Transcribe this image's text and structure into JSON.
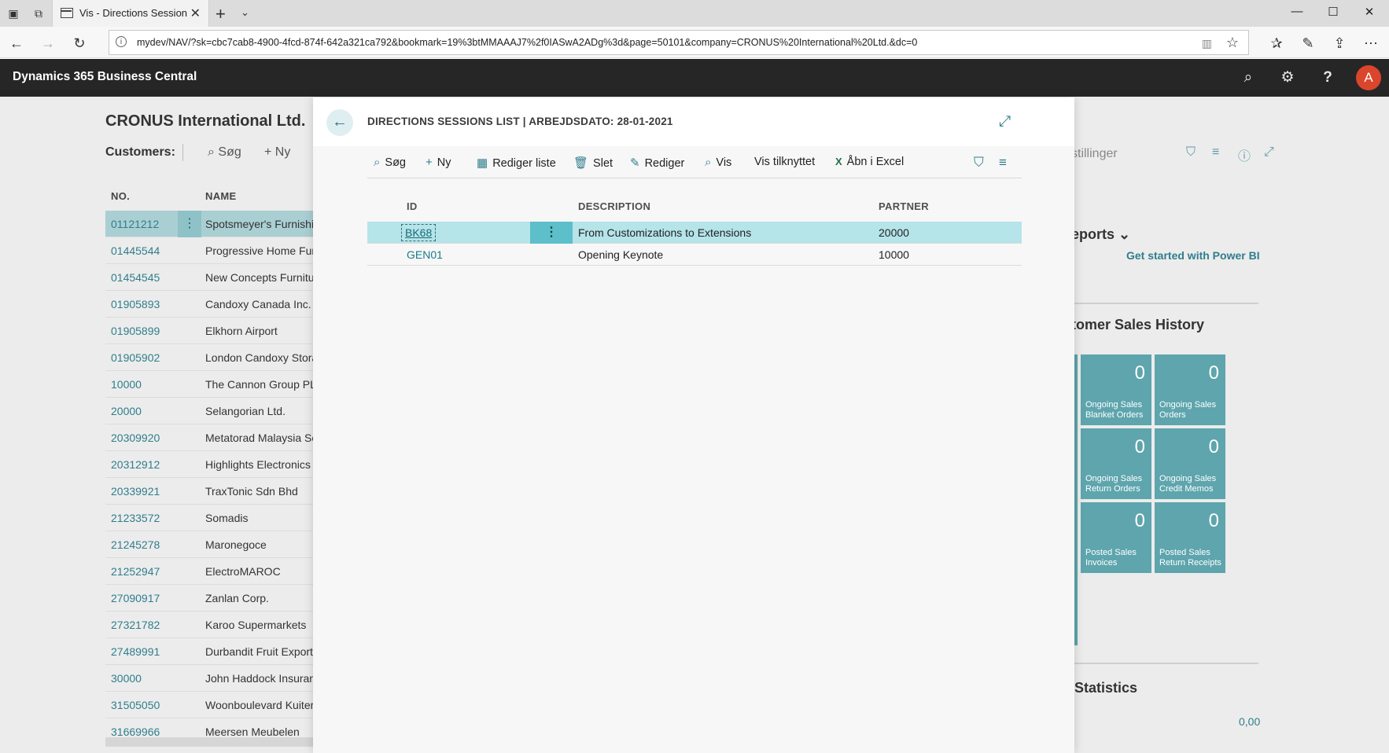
{
  "browser": {
    "tab_title": "Vis - Directions Session:",
    "url": "mydev/NAV/?sk=cbc7cab8-4900-4fcd-874f-642a321ca792&bookmark=19%3btMMAAAJ7%2f0IASwA2ADg%3d&page=50101&company=CRONUS%20International%20Ltd.&dc=0"
  },
  "app": {
    "brand": "Dynamics 365 Business Central",
    "avatar_initial": "A"
  },
  "background": {
    "company": "CRONUS International Ltd.",
    "customers_label": "Customers:",
    "search_label": "Søg",
    "new_label": "Ny",
    "col_no": "NO.",
    "col_name": "NAME",
    "rows": [
      {
        "no": "01121212",
        "name": "Spotsmeyer's Furnishi"
      },
      {
        "no": "01445544",
        "name": "Progressive Home Fur"
      },
      {
        "no": "01454545",
        "name": "New Concepts Furnitu"
      },
      {
        "no": "01905893",
        "name": "Candoxy Canada Inc."
      },
      {
        "no": "01905899",
        "name": "Elkhorn Airport"
      },
      {
        "no": "01905902",
        "name": "London Candoxy Stora"
      },
      {
        "no": "10000",
        "name": "The Cannon Group PLC"
      },
      {
        "no": "20000",
        "name": "Selangorian Ltd."
      },
      {
        "no": "20309920",
        "name": "Metatorad Malaysia Sc"
      },
      {
        "no": "20312912",
        "name": "Highlights Electronics"
      },
      {
        "no": "20339921",
        "name": "TraxTonic Sdn Bhd"
      },
      {
        "no": "21233572",
        "name": "Somadis"
      },
      {
        "no": "21245278",
        "name": "Maronegoce"
      },
      {
        "no": "21252947",
        "name": "ElectroMAROC"
      },
      {
        "no": "27090917",
        "name": "Zanlan Corp."
      },
      {
        "no": "27321782",
        "name": "Karoo Supermarkets"
      },
      {
        "no": "27489991",
        "name": "Durbandit Fruit Export"
      },
      {
        "no": "30000",
        "name": "John Haddock Insuran"
      },
      {
        "no": "31505050",
        "name": "Woonboulevard Kuiter"
      },
      {
        "no": "31669966",
        "name": "Meersen Meubelen"
      }
    ],
    "stillinger_text": "stillinger",
    "reports_text": "eports",
    "power_bi_link": "Get started with Power BI",
    "sales_history_title": "tomer Sales History",
    "tiles": [
      {
        "value": "0",
        "label": "Ongoing Sales Blanket Orders"
      },
      {
        "value": "0",
        "label": "Ongoing Sales Orders"
      },
      {
        "value": "0",
        "label": "Ongoing Sales Return Orders"
      },
      {
        "value": "0",
        "label": "Ongoing Sales Credit Memos"
      },
      {
        "value": "0",
        "label": "Posted Sales Invoices"
      },
      {
        "value": "0",
        "label": "Posted Sales Return Receipts"
      }
    ],
    "statistics_title": "Statistics",
    "statistics_value": "0,00"
  },
  "modal": {
    "title": "DIRECTIONS SESSIONS LIST | ARBEJDSDATO: 28-01-2021",
    "actions": {
      "search": "Søg",
      "new": "Ny",
      "edit_list": "Rediger liste",
      "delete": "Slet",
      "edit": "Rediger",
      "view": "Vis",
      "view_attached": "Vis tilknyttet",
      "open_excel": "Åbn i Excel"
    },
    "columns": {
      "id": "ID",
      "description": "DESCRIPTION",
      "partner": "PARTNER"
    },
    "rows": [
      {
        "id": "BK68",
        "description": "From Customizations to Extensions",
        "partner": "20000"
      },
      {
        "id": "GEN01",
        "description": "Opening Keynote",
        "partner": "10000"
      }
    ]
  }
}
